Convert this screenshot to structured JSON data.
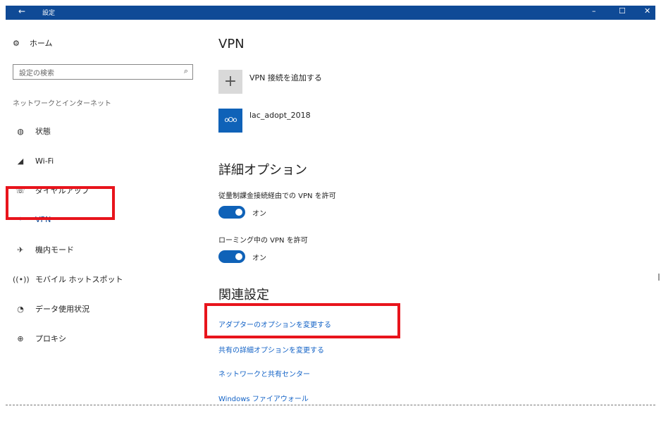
{
  "window": {
    "back_glyph": "←",
    "title": "設定",
    "minimize_glyph": "–",
    "maximize_glyph": "☐",
    "close_glyph": "✕"
  },
  "sidebar": {
    "home_label": "ホーム",
    "search_placeholder": "設定の検索",
    "section_label": "ネットワークとインターネット",
    "items": [
      {
        "label": "状態",
        "icon": "globe-icon"
      },
      {
        "label": "Wi-Fi",
        "icon": "wifi-icon"
      },
      {
        "label": "ダイヤルアップ",
        "icon": "phone-icon"
      },
      {
        "label": "VPN",
        "icon": "vpn-icon"
      },
      {
        "label": "機内モード",
        "icon": "airplane-icon"
      },
      {
        "label": "モバイル ホットスポット",
        "icon": "hotspot-icon"
      },
      {
        "label": "データ使用状況",
        "icon": "data-usage-icon"
      },
      {
        "label": "プロキシ",
        "icon": "proxy-icon"
      }
    ],
    "active_item": "VPN"
  },
  "main": {
    "vpn_heading": "VPN",
    "add_vpn_label": "VPN 接続を追加する",
    "connection_name": "lac_adopt_2018",
    "advanced_heading": "詳細オプション",
    "option_metered_label": "従量制課金接続経由での VPN を許可",
    "option_metered_state": "オン",
    "option_roaming_label": "ローミング中の VPN を許可",
    "option_roaming_state": "オン",
    "related_heading": "関連設定",
    "links": [
      "アダプターのオプションを変更する",
      "共有の詳細オプションを変更する",
      "ネットワークと共有センター",
      "Windows ファイアウォール"
    ]
  },
  "colors": {
    "titlebar": "#0f4a96",
    "accent": "#0f62b8",
    "link": "#1262c6",
    "highlight": "#e8141c"
  }
}
